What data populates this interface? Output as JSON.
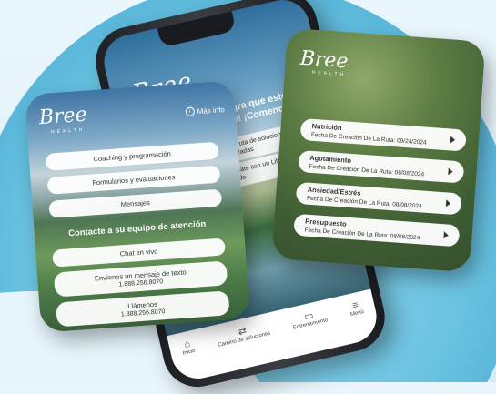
{
  "brand": {
    "logo": "Bree",
    "logo_sub": "HEALTH"
  },
  "center_phone": {
    "welcome": "¡Nos alegra que estés aquí, Brooke! ¡Comencemos!",
    "card1": "Crea una ruta de soluciones personalizadas",
    "card2": "Comunícate con un Life Coach certificado",
    "nav": [
      {
        "icon": "home-icon",
        "label": "Inicio"
      },
      {
        "icon": "route-icon",
        "label": "Camino de soluciones"
      },
      {
        "icon": "training-icon",
        "label": "Entrenamiento"
      },
      {
        "icon": "menu-icon",
        "label": "Menú"
      }
    ]
  },
  "left_card": {
    "info_link": "Más info",
    "buttons": [
      "Coaching y programación",
      "Formularios y evaluaciones",
      "Mensajes"
    ],
    "heading": "Contacte a su equipo de atención",
    "contact": [
      {
        "label": "Chat en vivo",
        "sub": ""
      },
      {
        "label": "Envíenos un mensaje de texto",
        "sub": "1.888.256.8070"
      },
      {
        "label": "Llámenos",
        "sub": "1.888.256.8070"
      }
    ]
  },
  "right_card": {
    "routes": [
      {
        "title": "Nutrición",
        "date": "Fecha De Creación De La Ruta: 09/24/2024"
      },
      {
        "title": "Agotamiento",
        "date": "Fecha De Creación De La Ruta: 08/08/2024"
      },
      {
        "title": "Ansiedad/Estrés",
        "date": "Fecha De Creación De La Ruta: 08/08/2024"
      },
      {
        "title": "Presupuesto",
        "date": "Fecha De Creación De La Ruta: 08/08/2024"
      }
    ]
  }
}
